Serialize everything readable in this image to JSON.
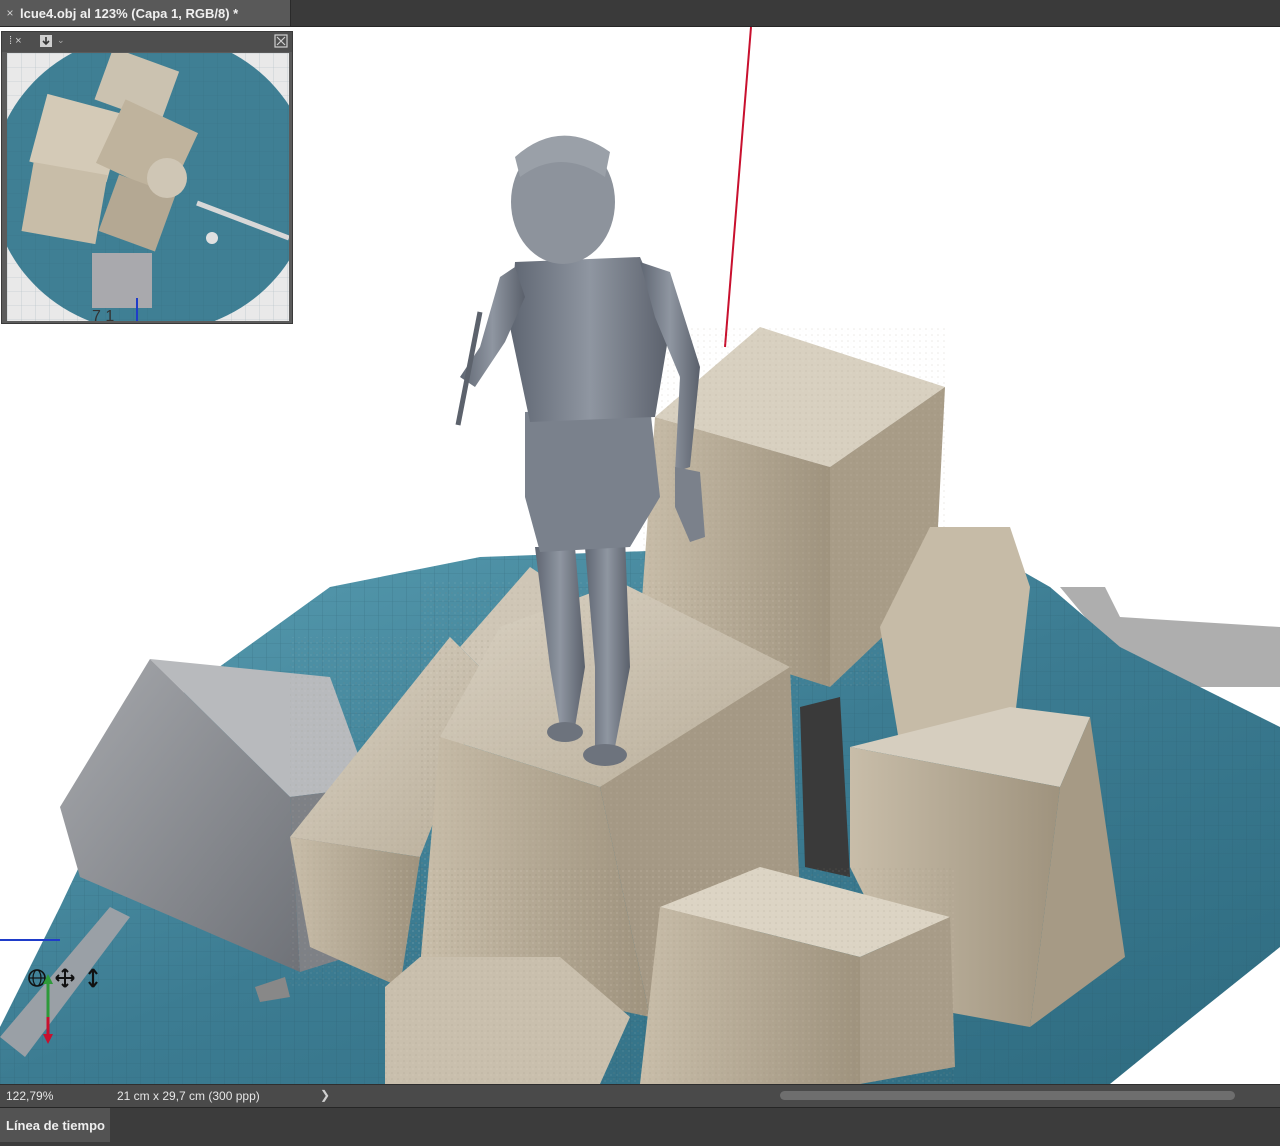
{
  "document": {
    "tab_title": "lcue4.obj al 123% (Capa 1, RGB/8) *",
    "close_glyph": "×"
  },
  "statusbar": {
    "zoom": "122,79%",
    "doc_size": "21 cm x 29,7 cm (300 ppp)",
    "arrow": "❯"
  },
  "navigator": {
    "grip": "⁞ ×",
    "overlay_text": "7  1"
  },
  "timeline": {
    "tab_label": "Línea de tiempo"
  },
  "colors": {
    "ui_dark": "#3a3a3a",
    "ui_mid": "#535353",
    "axis_red": "#c8102e",
    "axis_blue": "#1f3cc9",
    "axis_green": "#2e9a3a",
    "water": "#3e7f95",
    "stone": "#c9bfae",
    "statue": "#7d8490"
  },
  "gizmo_icons": [
    "orbit-icon",
    "pan-icon",
    "dolly-icon"
  ]
}
